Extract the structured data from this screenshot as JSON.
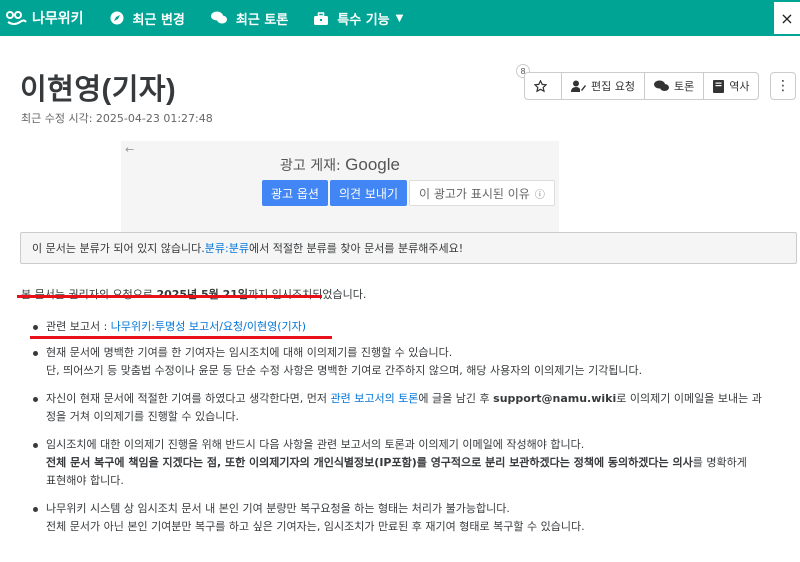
{
  "nav": {
    "logo": "나무위키",
    "items": [
      {
        "label": "최근 변경",
        "icon": "compass-icon"
      },
      {
        "label": "최근 토론",
        "icon": "comments-icon"
      },
      {
        "label": "특수 기능",
        "icon": "toolbox-icon"
      }
    ],
    "close": "×"
  },
  "document": {
    "title": "이현영(기자)",
    "modified": "최근 수정 시각: 2025-04-23 01:27:48"
  },
  "toolbar": {
    "star_count": "8",
    "edit_request": "편집 요청",
    "discussion": "토론",
    "history": "역사",
    "more": "⋮"
  },
  "ad": {
    "back": "←",
    "label_prefix": "광고 게재: ",
    "label_brand": "Google",
    "options": "광고 옵션",
    "feedback": "의견 보내기",
    "why": "이 광고가 표시된 이유",
    "why_icon": "ⓘ"
  },
  "notice": {
    "prefix": "이 문서는 분류가 되어 있지 않습니다. ",
    "link": "분류:분류",
    "suffix": "에서 적절한 분류를 찾아 문서를 분류해주세요!"
  },
  "statement": {
    "prefix": "본 문서는 권리자의 요청으로 ",
    "date": "2025년 5월 21일",
    "suffix": "까지 임시조치되었습니다."
  },
  "bullets": {
    "b1_label": "관련 보고서 : ",
    "b1_link": "나무위키:투명성 보고서/요청/이현영(기자)",
    "b2_line1": "현재 문서에 명백한 기여를 한 기여자는 임시조치에 대해 이의제기를 진행할 수 있습니다.",
    "b2_line2": "단, 띄어쓰기 등 맞춤법 수정이나 윤문 등 단순 수정 사항은 명백한 기여로 간주하지 않으며, 해당 사용자의 이의제기는 기각됩니다.",
    "b3_prefix": "자신이 현재 문서에 적절한 기여를 하였다고 생각한다면, 먼저 ",
    "b3_link": "관련 보고서의 토론",
    "b3_mid": "에 글을 남긴 후 ",
    "b3_email": "support@namu.wiki",
    "b3_suffix": "로 이의제기 이메일을 보내는 과",
    "b3_line2": "정을 거쳐 이의제기를 진행할 수 있습니다.",
    "b4_line1": "임시조치에 대한 이의제기 진행을 위해 반드시 다음 사항을 관련 보고서의 토론과 이의제기 이메일에 작성해야 합니다.",
    "b4_bold": "전체 문서 복구에 책임을 지겠다는 점, 또한 이의제기자의 개인식별정보(IP포함)를 영구적으로 분리 보관하겠다는 정책에 동의하겠다는 의사",
    "b4_suffix": "를 명확하게",
    "b4_line3": "표현해야 합니다.",
    "b5_line1": "나무위키 시스템 상 임시조치 문서 내 본인 기여 분량만 복구요청을 하는 형태는 처리가 불가능합니다.",
    "b5_line2": "전체 문서가 아닌 본인 기여분만 복구를 하고 싶은 기여자는, 임시조치가 만료된 후 재기여 형태로 복구할 수 있습니다."
  },
  "colors": {
    "brand": "#00a495",
    "link": "#0275d8",
    "ad_button": "#4285f4",
    "annotation_red": "#e8111a"
  }
}
